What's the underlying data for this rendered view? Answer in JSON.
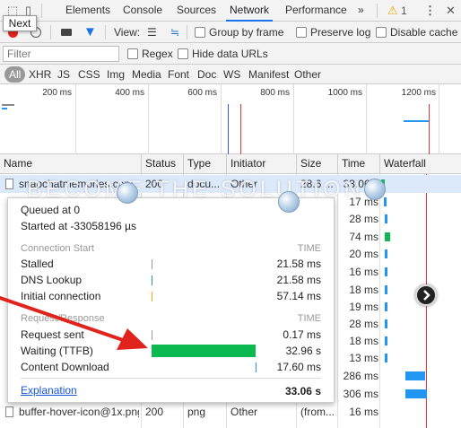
{
  "tooltip": {
    "next": "Next"
  },
  "tabs": [
    {
      "label": "Elements"
    },
    {
      "label": "Console"
    },
    {
      "label": "Sources"
    },
    {
      "label": "Network"
    },
    {
      "label": "Performance"
    },
    {
      "label": "»"
    }
  ],
  "warnings": {
    "count": "1"
  },
  "toolbar": {
    "view_label": "View:",
    "group_by_frame": "Group by frame",
    "preserve_log": "Preserve log",
    "disable_cache": "Disable cache"
  },
  "filter": {
    "placeholder": "Filter",
    "regex": "Regex",
    "hide_data_urls": "Hide data URLs"
  },
  "types": [
    "All",
    "XHR",
    "JS",
    "CSS",
    "Img",
    "Media",
    "Font",
    "Doc",
    "WS",
    "Manifest",
    "Other"
  ],
  "overview_ticks": [
    "200 ms",
    "400 ms",
    "600 ms",
    "800 ms",
    "1000 ms",
    "1200 ms"
  ],
  "columns": [
    "Name",
    "Status",
    "Type",
    "Initiator",
    "Size",
    "Time",
    "Waterfall"
  ],
  "first_row": {
    "name": "snapchatmemories.com",
    "status": "200",
    "type": "docu...",
    "initiator": "Other",
    "size": "28.6 ...",
    "time": "33.06 s"
  },
  "last_row": {
    "name": "buffer-hover-icon@1x.png",
    "status": "200",
    "type": "png",
    "initiator": "Other",
    "size": "(from...",
    "time": "16 ms"
  },
  "times": [
    "17 ms",
    "28 ms",
    "74 ms",
    "20 ms",
    "16 ms",
    "18 ms",
    "19 ms",
    "28 ms",
    "18 ms",
    "13 ms",
    "286 ms",
    "306 ms"
  ],
  "watermark": "BECOME THE SOLUTION",
  "popup": {
    "queued": "Queued at 0",
    "started": "Started at -33058196 µs",
    "section1": "Connection Start",
    "section2": "Request/Response",
    "time_header": "TIME",
    "items1": [
      {
        "label": "Stalled",
        "time": "21.58 ms"
      },
      {
        "label": "DNS Lookup",
        "time": "21.58 ms"
      },
      {
        "label": "Initial connection",
        "time": "57.14 ms"
      }
    ],
    "items2": [
      {
        "label": "Request sent",
        "time": "0.17 ms"
      },
      {
        "label": "Waiting (TTFB)",
        "time": "32.96 s"
      },
      {
        "label": "Content Download",
        "time": "17.60 ms"
      }
    ],
    "explanation": "Explanation",
    "total": "33.06 s"
  },
  "colors": {
    "accent": "#1a73e8",
    "waiting_green": "#0cb950",
    "waterfall_blue": "#2196f3",
    "arrow_red": "#e0231c"
  }
}
